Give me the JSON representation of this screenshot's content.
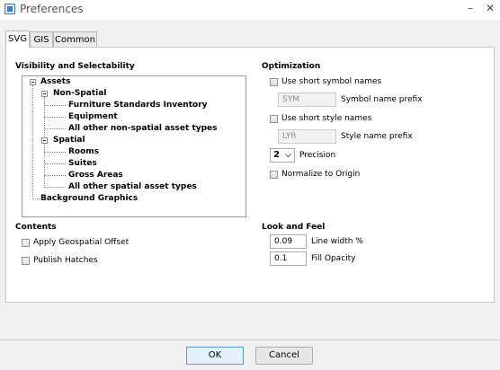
{
  "window": {
    "title": "Preferences",
    "minimize_glyph": "–",
    "close_glyph": "✕"
  },
  "tabs": [
    {
      "label": "SVG",
      "active": true
    },
    {
      "label": "GIS",
      "active": false
    },
    {
      "label": "Common",
      "active": false
    }
  ],
  "visibility": {
    "title": "Visibility and Selectability",
    "tree": [
      {
        "label": "Assets"
      },
      {
        "label": "Non-Spatial"
      },
      {
        "label": "Furniture Standards Inventory"
      },
      {
        "label": "Equipment"
      },
      {
        "label": "All other non-spatial asset types"
      },
      {
        "label": "Spatial"
      },
      {
        "label": "Rooms"
      },
      {
        "label": "Suites"
      },
      {
        "label": "Gross Areas"
      },
      {
        "label": "All other spatial asset types"
      },
      {
        "label": "Background Graphics"
      }
    ]
  },
  "optimization": {
    "title": "Optimization",
    "short_symbol_label": "Use short symbol names",
    "short_symbol_checked": false,
    "symbol_prefix_value": "SYM",
    "symbol_prefix_label": "Symbol name prefix",
    "short_style_label": "Use short style names",
    "short_style_checked": false,
    "style_prefix_value": "LYR",
    "style_prefix_label": "Style name prefix",
    "precision_value": "2",
    "precision_label": "Precision",
    "normalize_label": "Normalize to Origin",
    "normalize_checked": false
  },
  "contents": {
    "title": "Contents",
    "geospatial_label": "Apply Geospatial Offset",
    "geospatial_checked": false,
    "hatches_label": "Publish Hatches",
    "hatches_checked": false
  },
  "look_and_feel": {
    "title": "Look and Feel",
    "line_width_value": "0.09",
    "line_width_label": "Line width %",
    "fill_opacity_value": "0.1",
    "fill_opacity_label": "Fill Opacity"
  },
  "buttons": {
    "ok_label": "OK",
    "cancel_label": "Cancel"
  }
}
